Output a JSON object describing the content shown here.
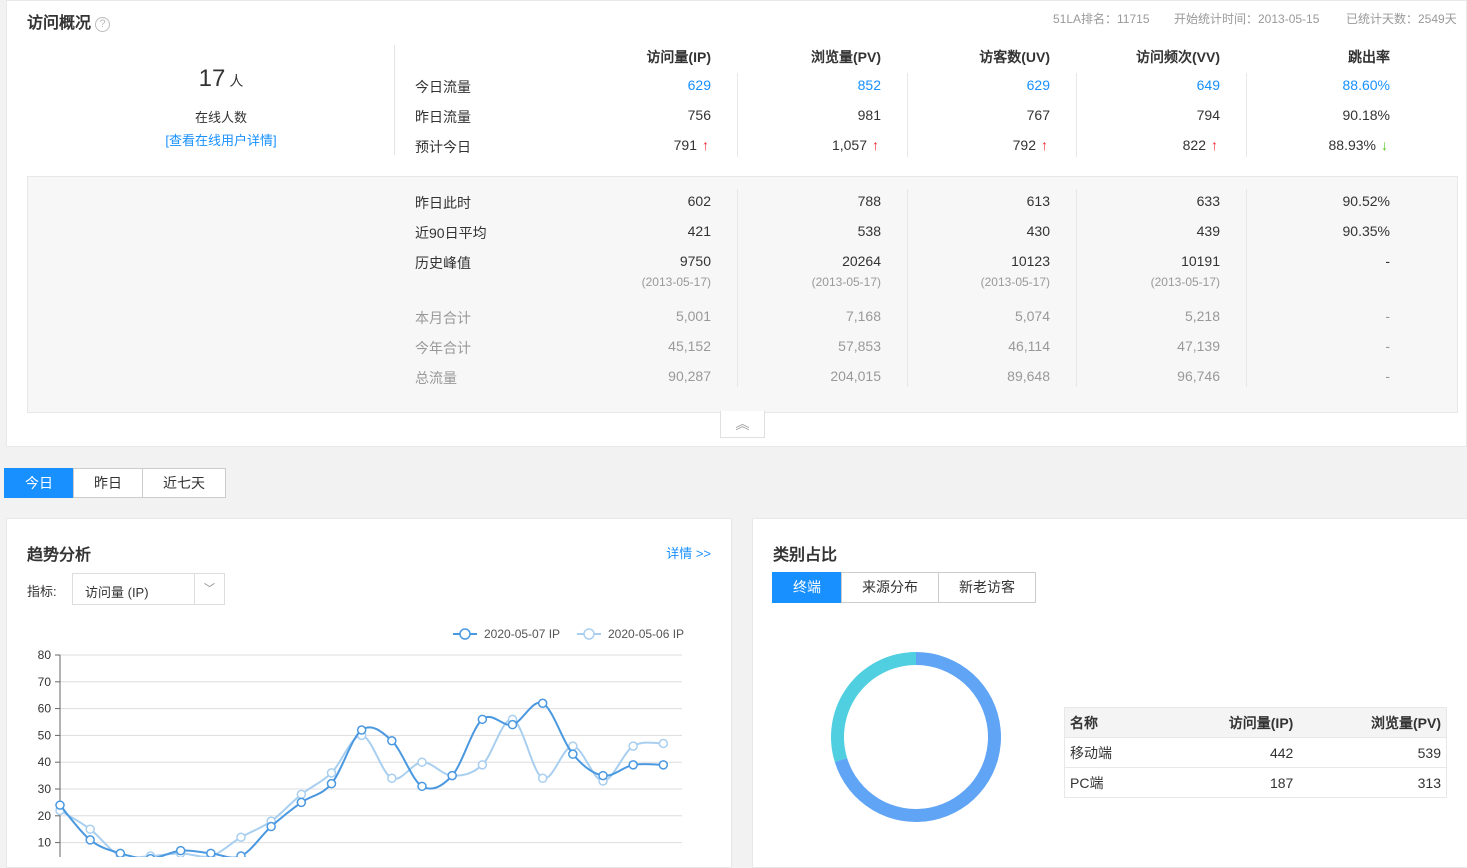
{
  "overview": {
    "title": "访问概况",
    "help_icon": "?",
    "rank": "51LA排名：11715",
    "start_time": "开始统计时间：2013-05-15",
    "days": "已统计天数：2549天",
    "online_count": "17",
    "online_unit": "人",
    "online_label": "在线人数",
    "online_link": "[查看在线用户详情]",
    "columns": [
      "访问量(IP)",
      "浏览量(PV)",
      "访客数(UV)",
      "访问频次(VV)",
      "跳出率"
    ],
    "rows": [
      {
        "label": "今日流量",
        "values": [
          "629",
          "852",
          "629",
          "649",
          "88.60%"
        ]
      },
      {
        "label": "昨日流量",
        "values": [
          "756",
          "981",
          "767",
          "794",
          "90.18%"
        ]
      },
      {
        "label": "预计今日",
        "values": [
          "791",
          "1,057",
          "792",
          "822",
          "88.93%"
        ]
      }
    ],
    "forecast_arrows": [
      "↑",
      "↑",
      "↑",
      "↑",
      "↓"
    ],
    "extra_rows": [
      {
        "label": "昨日此时",
        "values": [
          "602",
          "788",
          "613",
          "633",
          "90.52%"
        ]
      },
      {
        "label": "近90日平均",
        "values": [
          "421",
          "538",
          "430",
          "439",
          "90.35%"
        ]
      },
      {
        "label": "历史峰值",
        "values": [
          "9750",
          "20264",
          "10123",
          "10191",
          "-"
        ]
      }
    ],
    "peak_dates": [
      "(2013-05-17)",
      "(2013-05-17)",
      "(2013-05-17)",
      "(2013-05-17)"
    ],
    "total_rows": [
      {
        "label": "本月合计",
        "values": [
          "5,001",
          "7,168",
          "5,074",
          "5,218",
          "-"
        ]
      },
      {
        "label": "今年合计",
        "values": [
          "45,152",
          "57,853",
          "46,114",
          "47,139",
          "-"
        ]
      },
      {
        "label": "总流量",
        "values": [
          "90,287",
          "204,015",
          "89,648",
          "96,746",
          "-"
        ]
      }
    ],
    "collapse_icon": "︽"
  },
  "range_tabs": [
    "今日",
    "昨日",
    "近七天"
  ],
  "trend": {
    "title": "趋势分析",
    "more": "详情 >>",
    "metric_label": "指标:",
    "metric_value": "访问量 (IP)",
    "dropdown_icon": "﹀"
  },
  "category": {
    "title": "类别占比",
    "tabs": [
      "终端",
      "来源分布",
      "新老访客"
    ],
    "table_headers": [
      "名称",
      "访问量(IP)",
      "浏览量(PV)"
    ],
    "table_rows": [
      {
        "name": "移动端",
        "ip": "442",
        "pv": "539"
      },
      {
        "name": "PC端",
        "ip": "187",
        "pv": "313"
      }
    ]
  },
  "chart_data": [
    {
      "type": "line",
      "title": "",
      "xlabel": "",
      "ylabel": "",
      "ylim": [
        0,
        80
      ],
      "yticks": [
        "80",
        "70",
        "60",
        "50",
        "40",
        "30",
        "20",
        "10"
      ],
      "grid": true,
      "legend": "top-right",
      "x": [
        0,
        1,
        2,
        3,
        4,
        5,
        6,
        7,
        8,
        9,
        10,
        11,
        12,
        13,
        14,
        15,
        16,
        17,
        18,
        19,
        20
      ],
      "series": [
        {
          "name": "2020-05-07 IP",
          "color": "#4a98e0",
          "values": [
            24,
            11,
            6,
            4,
            7,
            6,
            5,
            16,
            25,
            32,
            52,
            48,
            31,
            35,
            56,
            54,
            62,
            43,
            35,
            39,
            39
          ]
        },
        {
          "name": "2020-05-06 IP",
          "color": "#a9cff0",
          "values": [
            22,
            15,
            5,
            5,
            6,
            5,
            12,
            18,
            28,
            36,
            50,
            34,
            40,
            35,
            39,
            56,
            34,
            46,
            33,
            46,
            47
          ]
        }
      ]
    },
    {
      "type": "pie",
      "title": "",
      "categories": [
        "移动端",
        "PC端"
      ],
      "values": [
        442,
        187
      ],
      "colors": [
        "#5fa4f5",
        "#4fcfe0"
      ]
    }
  ]
}
